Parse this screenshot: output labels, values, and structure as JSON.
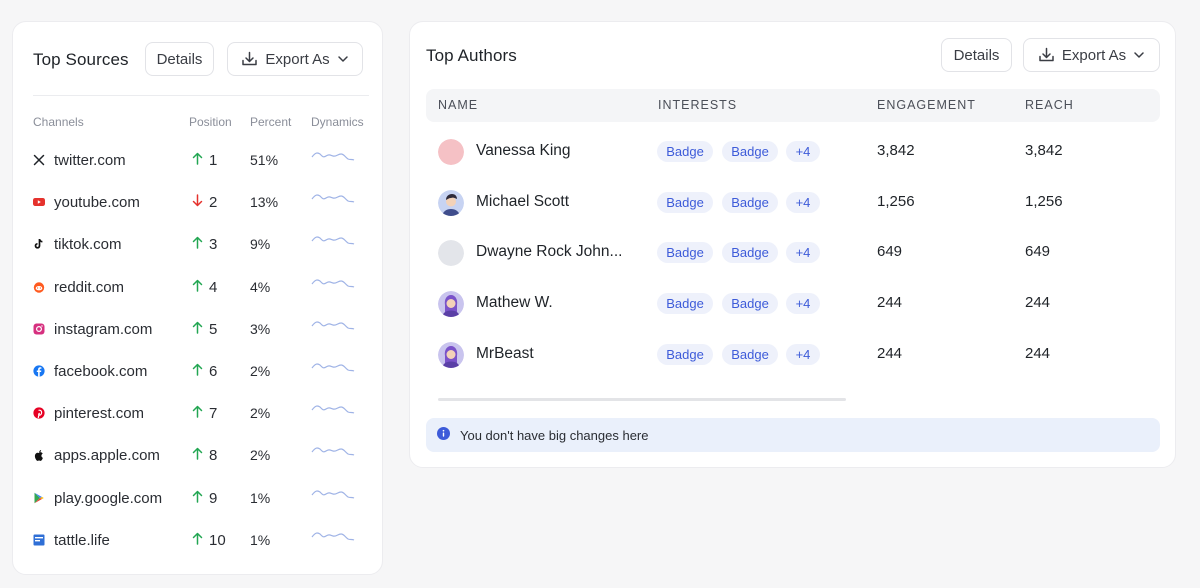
{
  "sources": {
    "title": "Top Sources",
    "details_label": "Details",
    "export_label": "Export As",
    "columns": [
      "Channels",
      "Position",
      "Percent",
      "Dynamics"
    ],
    "rows": [
      {
        "name": "twitter.com",
        "position": "1",
        "trend": "up",
        "percent": "51%",
        "icon": "x-logo-icon",
        "color": "#1f2328"
      },
      {
        "name": "youtube.com",
        "position": "2",
        "trend": "down",
        "percent": "13%",
        "icon": "youtube-icon",
        "color": "#e5322d"
      },
      {
        "name": "tiktok.com",
        "position": "3",
        "trend": "up",
        "percent": "9%",
        "icon": "tiktok-icon",
        "color": "#111111"
      },
      {
        "name": "reddit.com",
        "position": "4",
        "trend": "up",
        "percent": "4%",
        "icon": "reddit-icon",
        "color": "#ff5a1f"
      },
      {
        "name": "instagram.com",
        "position": "5",
        "trend": "up",
        "percent": "3%",
        "icon": "instagram-icon",
        "color": "#d6307f"
      },
      {
        "name": "facebook.com",
        "position": "6",
        "trend": "up",
        "percent": "2%",
        "icon": "facebook-icon",
        "color": "#1877f2"
      },
      {
        "name": "pinterest.com",
        "position": "7",
        "trend": "up",
        "percent": "2%",
        "icon": "pinterest-icon",
        "color": "#e60023"
      },
      {
        "name": "apps.apple.com",
        "position": "8",
        "trend": "up",
        "percent": "2%",
        "icon": "apple-icon",
        "color": "#111111"
      },
      {
        "name": "play.google.com",
        "position": "9",
        "trend": "up",
        "percent": "1%",
        "icon": "google-play-icon",
        "color": "#34a853"
      },
      {
        "name": "tattle.life",
        "position": "10",
        "trend": "up",
        "percent": "1%",
        "icon": "tattle-icon",
        "color": "#2f6fd6"
      }
    ]
  },
  "authors": {
    "title": "Top Authors",
    "details_label": "Details",
    "export_label": "Export As",
    "columns": [
      "NAME",
      "INTERESTS",
      "ENGAGEMENT",
      "REACH"
    ],
    "rows": [
      {
        "name": "Vanessa King",
        "badges": [
          "Badge",
          "Badge",
          "+4"
        ],
        "engagement": "3,842",
        "reach": "3,842",
        "avatar": "pink-circle"
      },
      {
        "name": "Michael Scott",
        "badges": [
          "Badge",
          "Badge",
          "+4"
        ],
        "engagement": "1,256",
        "reach": "1,256",
        "avatar": "illustrated-man"
      },
      {
        "name": "Dwayne Rock John...",
        "badges": [
          "Badge",
          "Badge",
          "+4"
        ],
        "engagement": "649",
        "reach": "649",
        "avatar": "gray-circle"
      },
      {
        "name": "Mathew W.",
        "badges": [
          "Badge",
          "Badge",
          "+4"
        ],
        "engagement": "244",
        "reach": "244",
        "avatar": "illustrated-woman"
      },
      {
        "name": "MrBeast",
        "badges": [
          "Badge",
          "Badge",
          "+4"
        ],
        "engagement": "244",
        "reach": "244",
        "avatar": "illustrated-woman"
      }
    ],
    "notice": "You don't have big changes here"
  },
  "colors": {
    "up": "#22a652",
    "down": "#e5322d",
    "accent": "#3d5bd9",
    "sparkline": "#9fb3e6"
  }
}
